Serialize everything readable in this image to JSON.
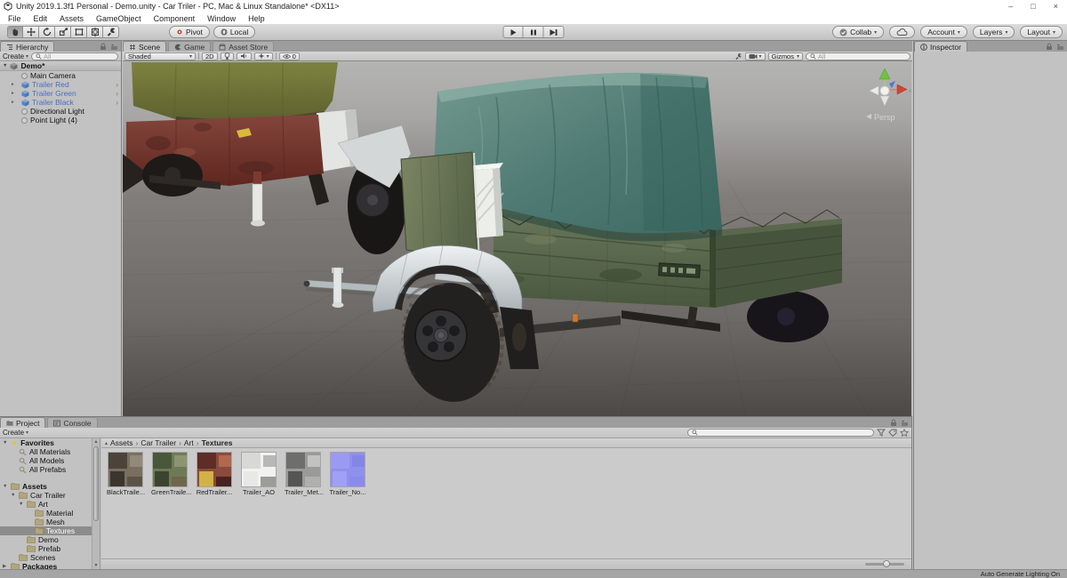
{
  "window": {
    "title": "Unity 2019.1.3f1 Personal - Demo.unity - Car Triler - PC, Mac & Linux Standalone* <DX11>",
    "minimize": "–",
    "maximize": "□",
    "close": "×"
  },
  "menu": {
    "items": [
      "File",
      "Edit",
      "Assets",
      "GameObject",
      "Component",
      "Window",
      "Help"
    ]
  },
  "toolbar": {
    "tools": [
      "hand",
      "move",
      "rotate",
      "scale",
      "rect",
      "transform",
      "custom"
    ],
    "active_tool": "hand",
    "pivot_label": "Pivot",
    "local_label": "Local",
    "collab_label": "Collab",
    "account_label": "Account",
    "layers_label": "Layers",
    "layout_label": "Layout"
  },
  "hierarchy": {
    "tab_label": "Hierarchy",
    "create_label": "Create",
    "search_placeholder": "All",
    "scene_name": "Demo*",
    "items": [
      {
        "label": "Main Camera",
        "type": "object"
      },
      {
        "label": "Trailer Red",
        "type": "prefab"
      },
      {
        "label": "Trailer Green",
        "type": "prefab"
      },
      {
        "label": "Trailer Black",
        "type": "prefab"
      },
      {
        "label": "Directional Light",
        "type": "object"
      },
      {
        "label": "Point Light (4)",
        "type": "object"
      }
    ]
  },
  "scene_view": {
    "tabs": [
      "Scene",
      "Game",
      "Asset Store"
    ],
    "shading_mode": "Shaded",
    "mode_2d_label": "2D",
    "visibility_count": "0",
    "gizmos_label": "Gizmos",
    "search_placeholder": "All",
    "persp_label": "Persp"
  },
  "inspector": {
    "tab_label": "Inspector"
  },
  "project": {
    "tab_project": "Project",
    "tab_console": "Console",
    "create_label": "Create",
    "search_placeholder": "",
    "breadcrumb": [
      "Assets",
      "Car Trailer",
      "Art",
      "Textures"
    ],
    "tree": [
      {
        "label": "Favorites",
        "level": 0,
        "icon": "star",
        "bold": true,
        "exp": "open"
      },
      {
        "label": "All Materials",
        "level": 1,
        "icon": "search"
      },
      {
        "label": "All Models",
        "level": 1,
        "icon": "search"
      },
      {
        "label": "All Prefabs",
        "level": 1,
        "icon": "search"
      },
      {
        "gap": true
      },
      {
        "label": "Assets",
        "level": 0,
        "icon": "folder",
        "bold": true,
        "exp": "open"
      },
      {
        "label": "Car Trailer",
        "level": 1,
        "icon": "folder",
        "exp": "open"
      },
      {
        "label": "Art",
        "level": 2,
        "icon": "folder",
        "exp": "open"
      },
      {
        "label": "Material",
        "level": 3,
        "icon": "folder"
      },
      {
        "label": "Mesh",
        "level": 3,
        "icon": "folder"
      },
      {
        "label": "Textures",
        "level": 3,
        "icon": "folder",
        "selected": true
      },
      {
        "label": "Demo",
        "level": 2,
        "icon": "folder"
      },
      {
        "label": "Prefab",
        "level": 2,
        "icon": "folder"
      },
      {
        "label": "Scenes",
        "level": 1,
        "icon": "folder"
      },
      {
        "label": "Packages",
        "level": 0,
        "icon": "folder",
        "bold": true,
        "exp": "closed"
      }
    ],
    "textures": [
      {
        "label": "BlackTraile...",
        "palette": [
          "#7a6f5f",
          "#4a443b",
          "#93897b",
          "#3a352e",
          "#5c5347"
        ]
      },
      {
        "label": "GreenTraile...",
        "palette": [
          "#6e7a54",
          "#49573a",
          "#8d9470",
          "#3b4430",
          "#70654e"
        ]
      },
      {
        "label": "RedTrailer...",
        "palette": [
          "#8a4a3c",
          "#5e2d26",
          "#b0684f",
          "#d1b244",
          "#46231e"
        ]
      },
      {
        "label": "Trailer_AO",
        "palette": [
          "#f2f2f0",
          "#d8d8d5",
          "#b8b8b5",
          "#e8e8e5",
          "#9c9c99"
        ]
      },
      {
        "label": "Trailer_Met...",
        "palette": [
          "#9a9a98",
          "#6e6e6c",
          "#c2c2c0",
          "#555553",
          "#b0b0ae"
        ]
      },
      {
        "label": "Trailer_No...",
        "palette": [
          "#8f8fee",
          "#9a9af2",
          "#8585e8",
          "#a0a0f4",
          "#8a8aec"
        ]
      }
    ]
  },
  "status_bar": {
    "text": "Auto Generate Lighting On"
  },
  "colors": {
    "prefab_text": "#4a6cc4",
    "selection_bg": "#8c8c8c",
    "tarp_teal": "#4e7a73",
    "body_green": "#5a6a4c",
    "trailer_red": "#7a3b31",
    "tarp_olive": "#747838",
    "normal_map_blue": "#8f8fee",
    "favorites_star": "#e2c23c"
  }
}
